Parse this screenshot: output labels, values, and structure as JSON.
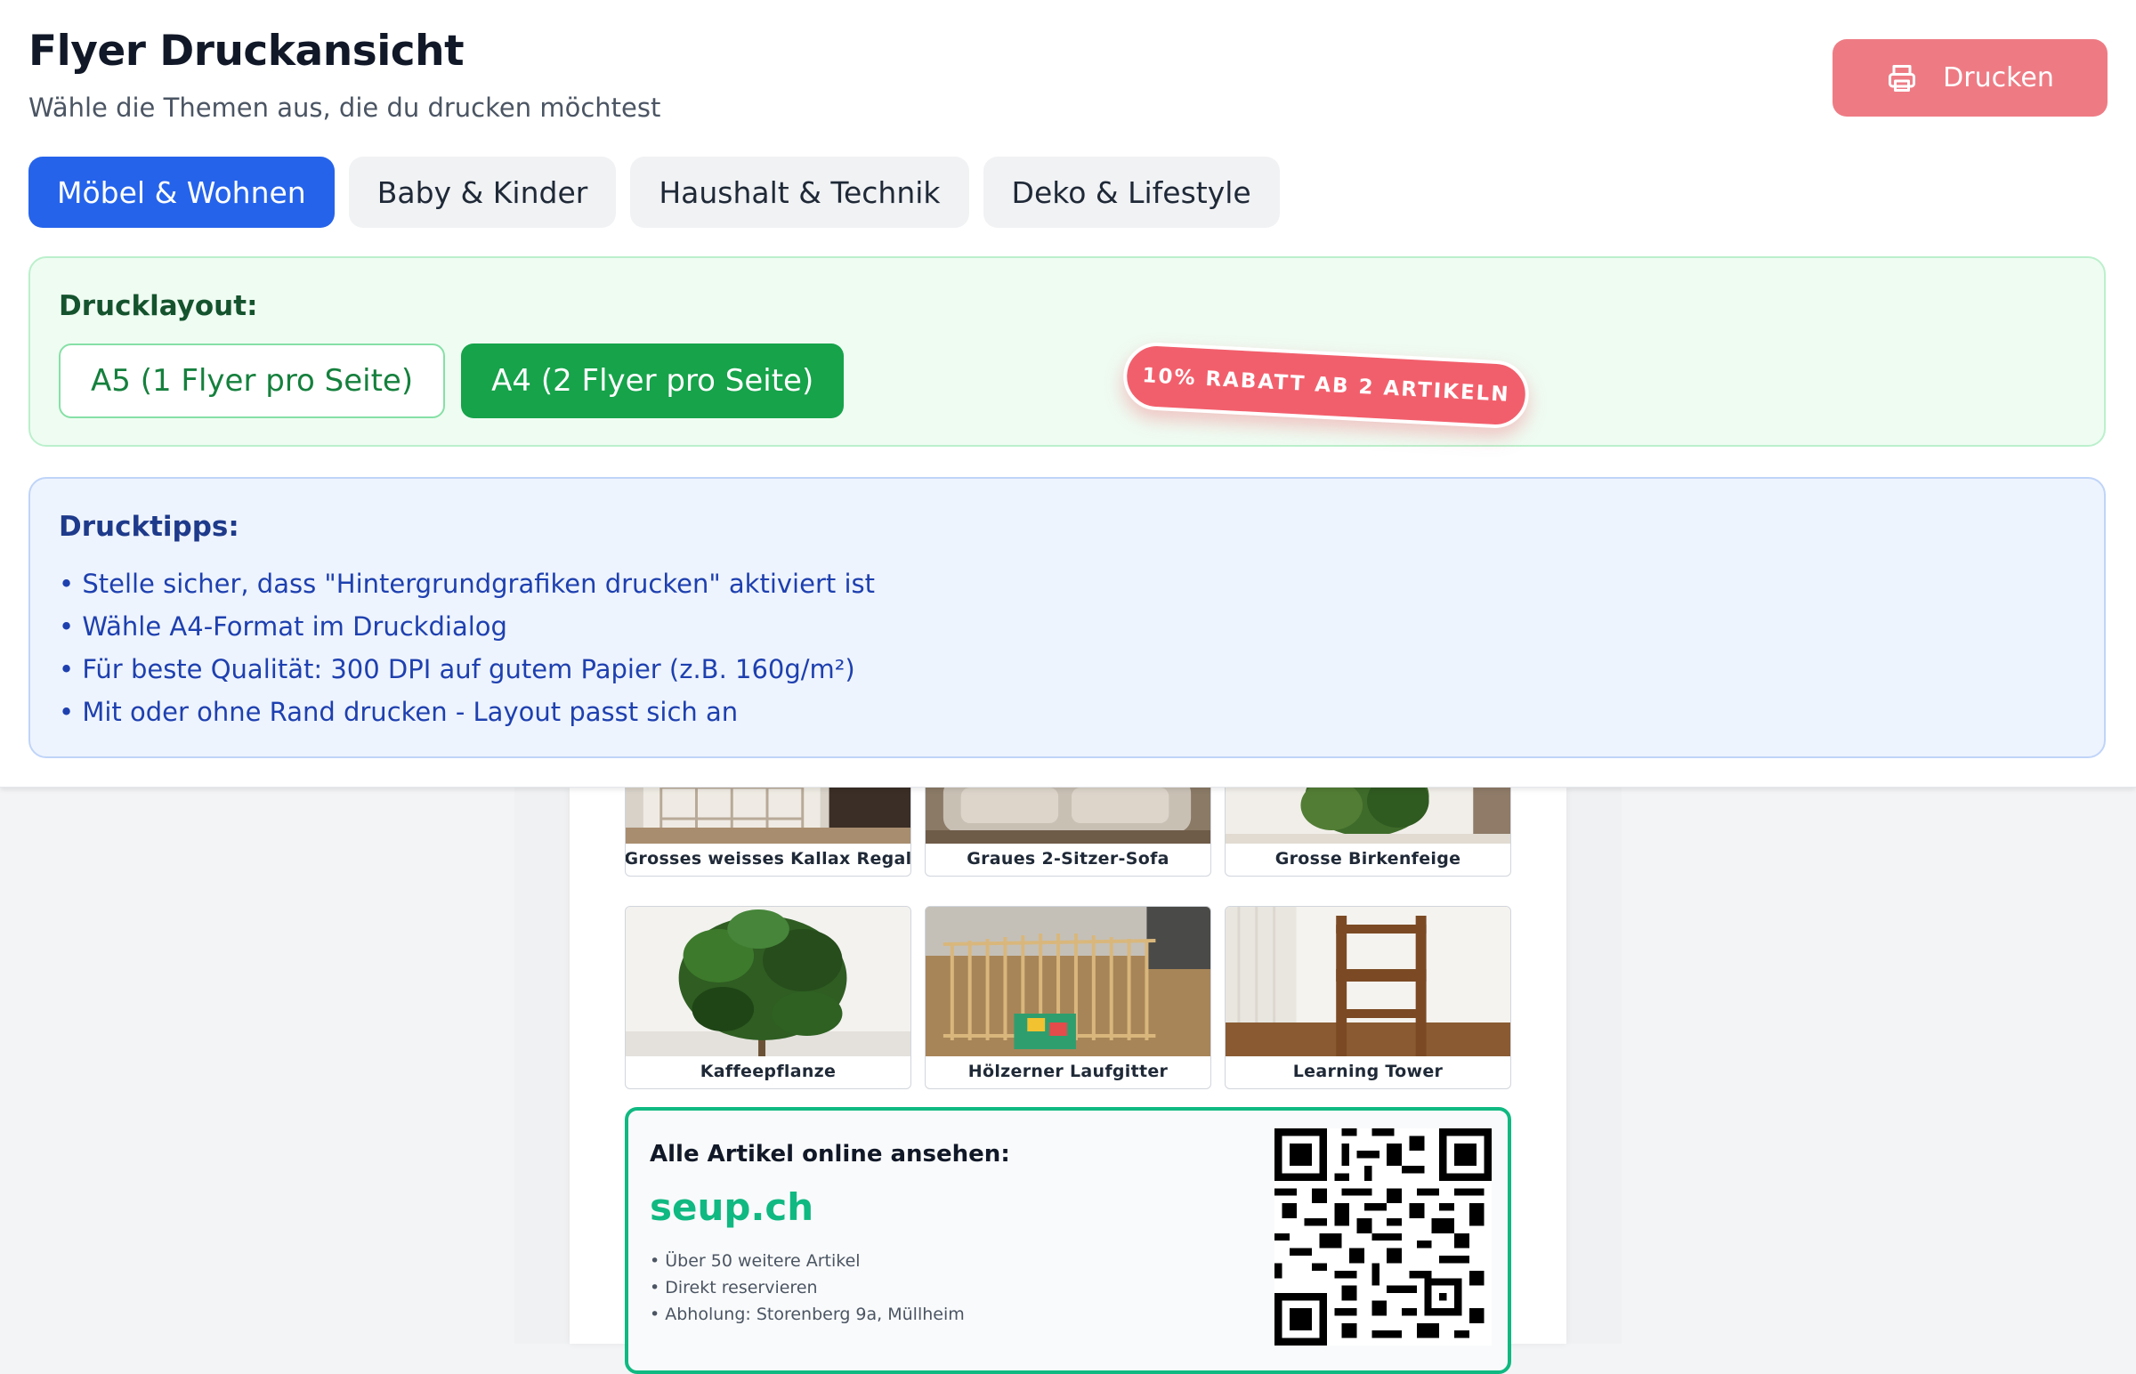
{
  "header": {
    "title": "Flyer Druckansicht",
    "subtitle": "Wähle die Themen aus, die du drucken möchtest",
    "print_label": "Drucken",
    "print_icon": "printer-icon"
  },
  "tabs": [
    {
      "label": "Möbel & Wohnen",
      "active": true
    },
    {
      "label": "Baby & Kinder",
      "active": false
    },
    {
      "label": "Haushalt & Technik",
      "active": false
    },
    {
      "label": "Deko & Lifestyle",
      "active": false
    }
  ],
  "layout": {
    "label": "Drucklayout:",
    "options": [
      {
        "label": "A5 (1 Flyer pro Seite)",
        "selected": false
      },
      {
        "label": "A4 (2 Flyer pro Seite)",
        "selected": true
      }
    ],
    "promo_badge": "10% RABATT AB 2 ARTIKELN"
  },
  "tips": {
    "title": "Drucktipps:",
    "items": [
      "• Stelle sicher, dass \"Hintergrundgrafiken drucken\" aktiviert ist",
      "• Wähle A4-Format im Druckdialog",
      "• Für beste Qualität: 300 DPI auf gutem Papier (z.B. 160g/m²)",
      "• Mit oder ohne Rand drucken - Layout passt sich an"
    ]
  },
  "flyer": {
    "products": [
      "Grosses weisses Kallax Regal",
      "Graues 2-Sitzer-Sofa",
      "Grosse Birkenfeige",
      "Kaffeepflanze",
      "Hölzerner Laufgitter",
      "Learning Tower"
    ],
    "cta": {
      "title": "Alle Artikel online ansehen:",
      "url": "seup.ch",
      "items": [
        "• Über 50 weitere Artikel",
        "• Direkt reservieren",
        "• Abholung: Storenberg 9a, Müllheim"
      ],
      "qr_icon": "qr-code"
    }
  },
  "colors": {
    "primary_blue": "#2563eb",
    "print_button": "#ee7b84",
    "green": "#16a34a",
    "accent_teal": "#10b981",
    "promo_red": "#f25f6c"
  }
}
